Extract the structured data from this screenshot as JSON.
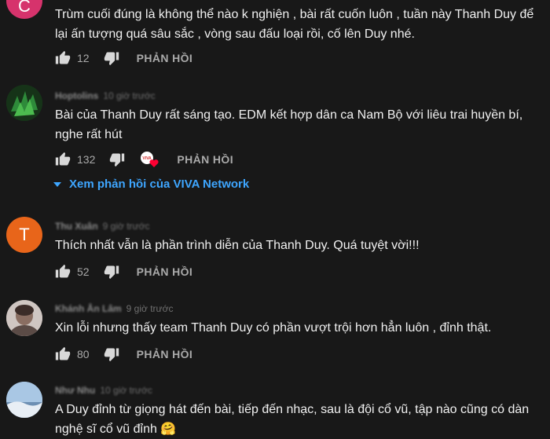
{
  "comments": [
    {
      "author": "",
      "time": "",
      "avatar_letter": "C",
      "avatar_color": "#d6336c",
      "text": "Trùm cuối đúng là không thể nào k nghiện , bài rất cuốn luôn , tuần này Thanh Duy để lại ấn tượng quá sâu sắc , vòng sau đấu loại rồi, cố lên Duy nhé.",
      "likes": "12",
      "reply_label": "PHẢN HỒI"
    },
    {
      "author": "Hoptolins",
      "time": "10 giờ trước",
      "avatar_color": "#2e7d32",
      "text": "Bài của Thanh Duy rất sáng tạo. EDM kết hợp dân ca Nam Bộ với liêu trai huyền bí, nghe rất hút",
      "likes": "132",
      "reply_label": "PHẢN HỒI",
      "heart_badge_text": "VIVA"
    },
    {
      "author": "Thu Xuân",
      "time": "9 giờ trước",
      "avatar_letter": "T",
      "avatar_color": "#e8651a",
      "text": "Thích nhất vẫn là phần trình diễn của Thanh Duy. Quá tuyệt vời!!!",
      "likes": "52",
      "reply_label": "PHẢN HỒI"
    },
    {
      "author": "Khánh Ân Lâm",
      "time": "9 giờ trước",
      "avatar_color": "#9e8e86",
      "text": "Xin lỗi nhưng thấy team Thanh Duy có phần vượt trội hơn hẳn luôn , đỉnh thật.",
      "likes": "80",
      "reply_label": "PHẢN HỒI"
    },
    {
      "author": "Như Nhu",
      "time": "10 giờ trước",
      "avatar_color": "#7da3c8",
      "text": "A Duy đỉnh từ giọng hát đến bài, tiếp đến nhạc, sau là đội cổ vũ, tập nào cũng có dàn nghệ sĩ cổ vũ đỉnh 🤗"
    }
  ],
  "view_replies": "Xem phản hồi của VIVA Network",
  "colors": {
    "background": "#181818",
    "link": "#3ea6ff",
    "muted": "#aaaaaa"
  }
}
